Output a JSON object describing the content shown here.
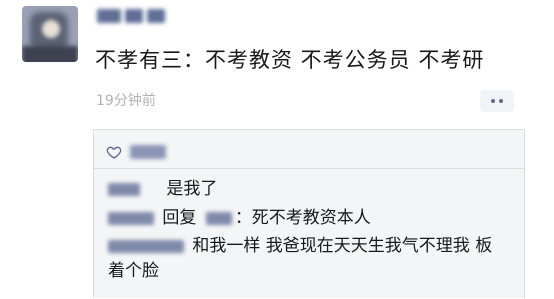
{
  "post": {
    "text": "不孝有三：不考教资 不考公务员 不考研",
    "timestamp": "19分钟前"
  },
  "comments": [
    {
      "text": "是我了"
    },
    {
      "action": "回复",
      "text": "：死不考教资本人"
    },
    {
      "text": "和我一样 我爸现在天天生我气不理我 板着个脸"
    }
  ]
}
